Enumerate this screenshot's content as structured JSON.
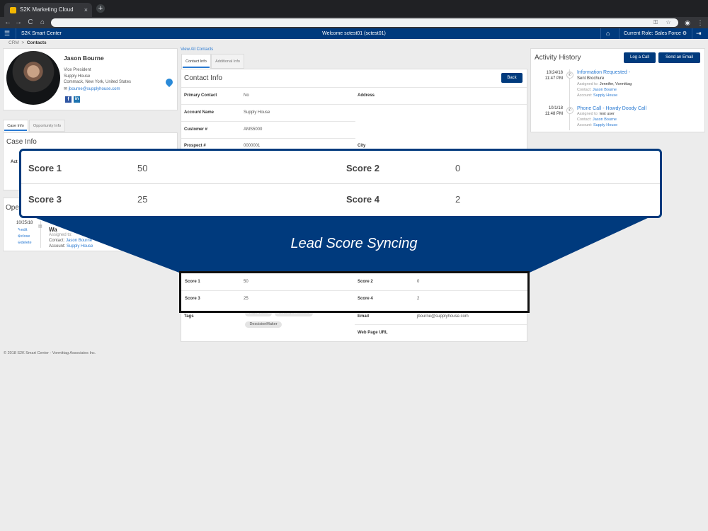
{
  "browser": {
    "tab_title": "S2K Marketing Cloud",
    "tab_close": "×",
    "new_tab": "+",
    "nav": [
      "←",
      "→",
      "C",
      "⌂"
    ],
    "omni_icons": [
      "⚿",
      "☆"
    ],
    "right_icons": [
      "◉",
      "⋮"
    ]
  },
  "appbar": {
    "brand": "S2K Smart Center",
    "welcome": "Welcome sctest01 (sctest01)",
    "role": "Current Role: Sales Force ⚙"
  },
  "breadcrumb": {
    "root": "CRM",
    "separator": ">",
    "current": "Contacts"
  },
  "profile": {
    "name": "Jason Bourne",
    "title": "Vice President",
    "company": "Supply House",
    "location": "Commack, New York, United States",
    "email": "jbourne@supplyhouse.com",
    "social": [
      "f",
      "in"
    ]
  },
  "left_tabs": [
    "Case Info",
    "Opportunity Info"
  ],
  "case_info": {
    "title": "Case Info",
    "partial_label": "Act"
  },
  "opportunity": {
    "partial_title": "Ope",
    "date": "10/25/18",
    "actions": [
      "edit",
      "close",
      "delete"
    ],
    "partial_name": "Wa",
    "assigned_prefix": "Assigned to:",
    "contact_label": "Contact:",
    "contact": "Jason Bourne",
    "account_label": "Account:",
    "account": "Supply House"
  },
  "center": {
    "view_all": "View All Contacts",
    "tabs": [
      "Contact Info",
      "Additional Info"
    ],
    "title": "Contact Info",
    "back_label": "Back",
    "rows": [
      {
        "label": "Primary Contact",
        "value": "No",
        "label2": "Address",
        "value2": ""
      },
      {
        "label": "Account Name",
        "value": "Supply House",
        "label2": "",
        "value2": ""
      },
      {
        "label": "Customer #",
        "value": "AMS5000",
        "label2": "",
        "value2": ""
      },
      {
        "label": "Prospect #",
        "value": "0000001",
        "label2": "City",
        "value2": ""
      }
    ],
    "scores": [
      {
        "label": "Score 1",
        "value": "50",
        "label2": "Score 2",
        "value2": "0"
      },
      {
        "label": "Score 3",
        "value": "25",
        "label2": "Score 4",
        "value2": "2"
      }
    ],
    "tags_label": "Tags",
    "tags": [
      "High Value",
      "Strategic Account",
      "DescisionMaker"
    ],
    "email_label": "Email",
    "email_value": "jbourne@supplyhouse.com",
    "webpage_label": "Web Page URL"
  },
  "activity": {
    "title": "Activity History",
    "log_call": "Log a Call",
    "send_email": "Send an Email",
    "items": [
      {
        "date": "10/24/18",
        "time": "11:47 PM",
        "subject": "Information Requested -",
        "detail": "Sent Brochure",
        "assigned_label": "Assigned to:",
        "assigned": "Jennifer, Vormittag",
        "contact_label": "Contact:",
        "contact": "Jason Bourne",
        "account_label": "Account:",
        "account": "Supply House"
      },
      {
        "date": "10/1/18",
        "time": "11:48 PM",
        "subject": "Phone Call - Howdy Doody Call",
        "detail": "",
        "assigned_label": "Assigned to:",
        "assigned": "test user",
        "contact_label": "Contact:",
        "contact": "Jason Bourne",
        "account_label": "Account:",
        "account": "Supply House"
      }
    ]
  },
  "callout": {
    "banner": "Lead Score Syncing",
    "scores": [
      {
        "label": "Score 1",
        "value": "50",
        "label2": "Score 2",
        "value2": "0"
      },
      {
        "label": "Score 3",
        "value": "25",
        "label2": "Score 4",
        "value2": "2"
      }
    ]
  },
  "footer": "© 2018 S2K Smart Center - Vormittag Associates Inc.",
  "colors": {
    "header": "#003a7d",
    "link": "#2a7ad2",
    "background": "#ececec"
  }
}
